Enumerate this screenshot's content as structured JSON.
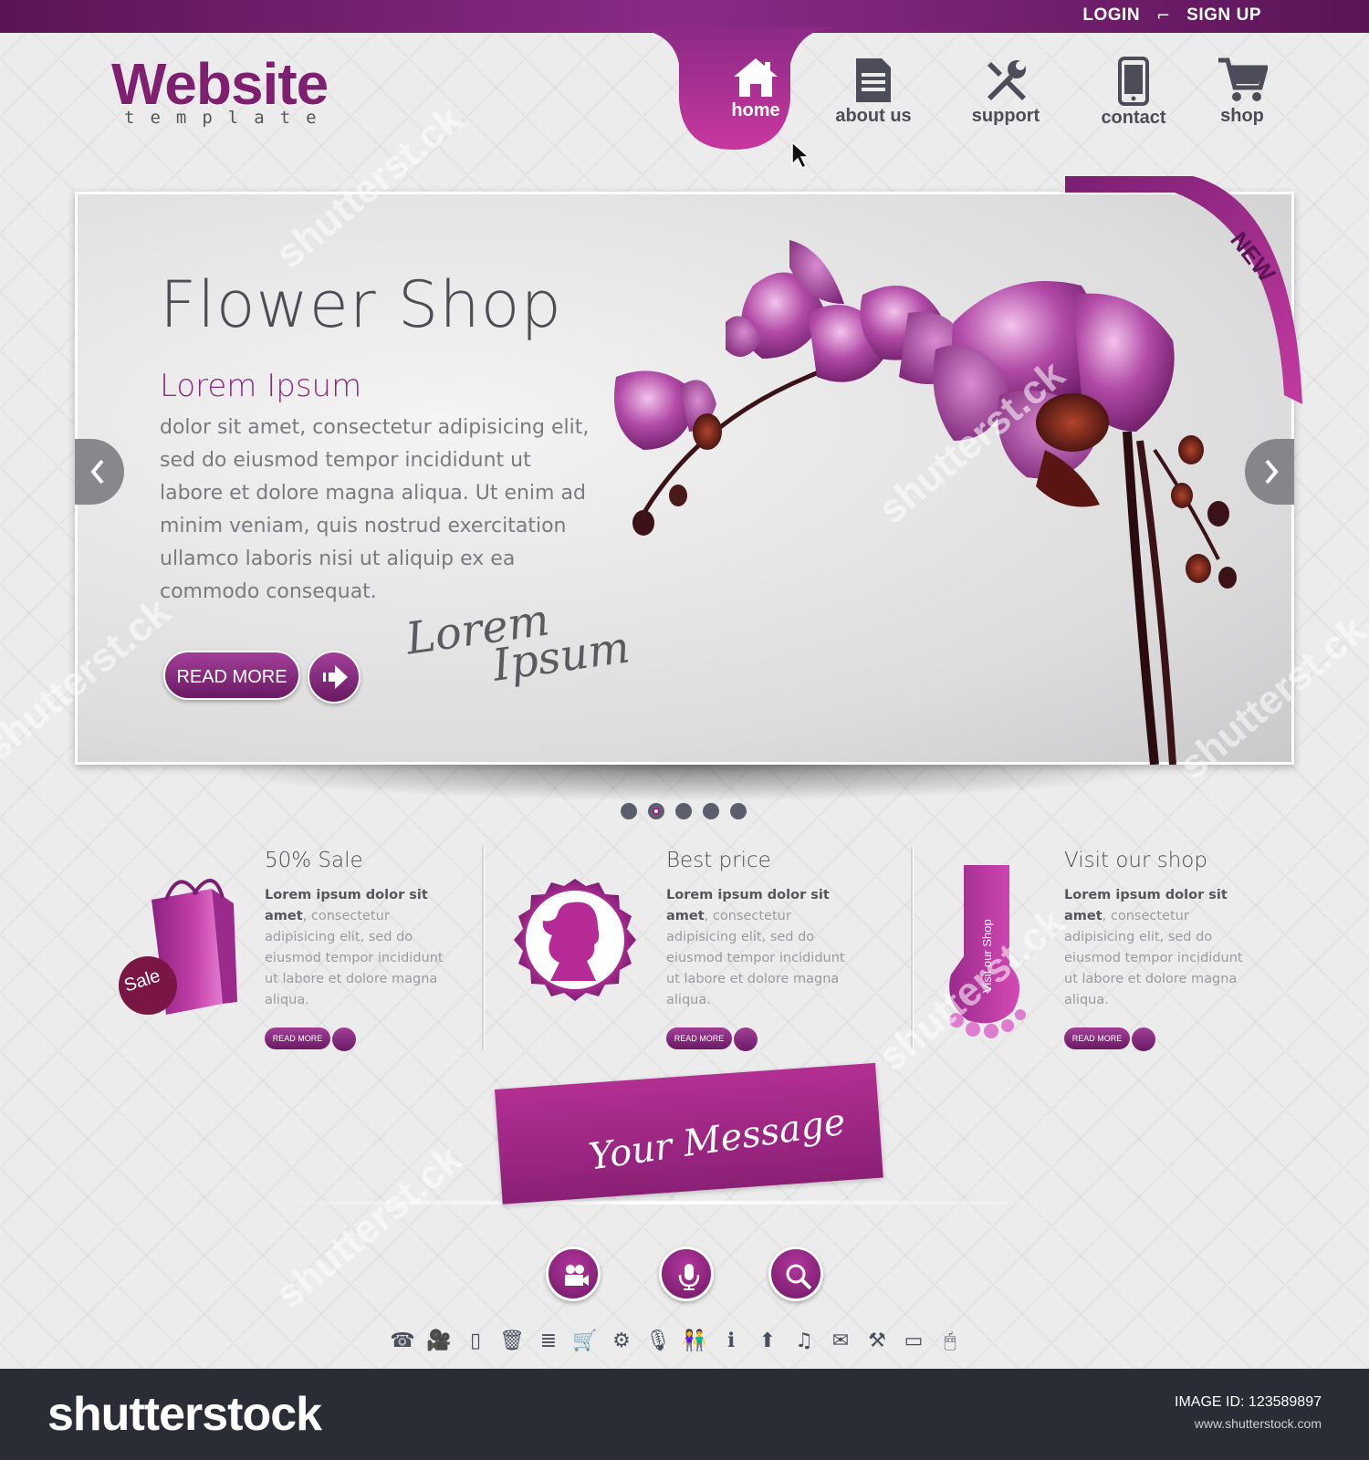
{
  "top_bar": {
    "login": "LOGIN",
    "sign": "SIGN",
    "up": "UP"
  },
  "logo": {
    "main_accent": "W",
    "main_rest": "ebsite",
    "sub": "template"
  },
  "nav": {
    "items": [
      {
        "label": "home",
        "icon": "home-icon",
        "active": true
      },
      {
        "label": "about us",
        "icon": "document-icon"
      },
      {
        "label": "support",
        "icon": "tools-icon"
      },
      {
        "label": "contact",
        "icon": "phone-icon"
      },
      {
        "label": "shop",
        "icon": "cart-icon"
      }
    ]
  },
  "hero": {
    "title": "Flower Shop",
    "subtitle": "Lorem Ipsum",
    "body": "dolor sit amet, consectetur adipisicing elit, sed do eiusmod tempor incididunt ut labore et dolore magna aliqua. Ut enim ad minim veniam, quis nostrud exercitation ullamco laboris nisi ut aliquip ex ea commodo consequat.",
    "button": "READ MORE",
    "script_line1": "Lorem",
    "script_line2": "Ipsum",
    "ribbon": "NEW"
  },
  "slider_dots": {
    "count": 5,
    "active_index": 1
  },
  "features": [
    {
      "title": "50% Sale",
      "bold": "Lorem ipsum dolor sit amet",
      "text": ", consectetur adipisicing elit, sed do eiusmod tempor incididunt ut labore et dolore magna aliqua.",
      "button": "READ MORE",
      "badge": "Sale"
    },
    {
      "title": "Best price",
      "bold": "Lorem ipsum dolor sit amet",
      "text": ", consectetur adipisicing elit, sed do eiusmod tempor incididunt ut labore et dolore magna aliqua.",
      "button": "READ MORE"
    },
    {
      "title": "Visit our shop",
      "bold": "Lorem ipsum dolor sit amet",
      "text": ", consectetur adipisicing elit, sed do eiusmod tempor incididunt ut labore et dolore magna aliqua.",
      "button": "READ MORE",
      "tag": "Visit our Shop"
    }
  ],
  "message": "Your Message",
  "media_buttons": [
    "video-camera-icon",
    "microphone-icon",
    "search-icon"
  ],
  "icon_row": [
    "phone-icon",
    "video-camera-icon",
    "mobile-icon",
    "trash-icon",
    "document-icon",
    "cart-icon",
    "gear-icon",
    "microphone-icon",
    "people-icon",
    "info-icon",
    "upload-icon",
    "music-icon",
    "mail-icon",
    "tools-icon",
    "battery-icon",
    "mouse-icon"
  ],
  "watermark": {
    "brand": "shutterstock",
    "image_id_label": "IMAGE ID: 123589897",
    "site": "www.shutterstock.com"
  },
  "colors": {
    "accent": "#8b2a86",
    "accent_light": "#c8379e",
    "text_dark": "#4d4d55",
    "background": "#ececed"
  }
}
